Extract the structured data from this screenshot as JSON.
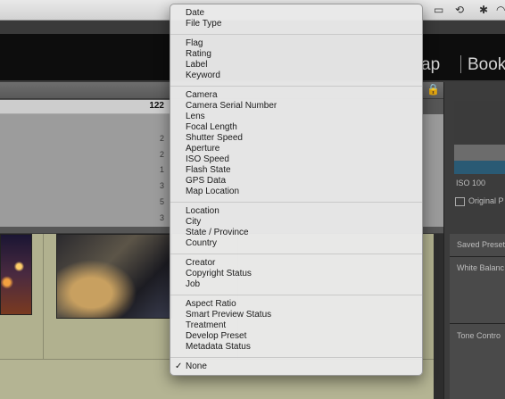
{
  "menubar": {
    "icons": [
      "screen-mirror-icon",
      "time-machine-icon",
      "bluetooth-icon",
      "wifi-icon"
    ]
  },
  "app": {
    "modules": [
      "ap",
      "Book"
    ]
  },
  "metadata_browser": {
    "header_count": "122",
    "counts": [
      "2",
      "2",
      "1",
      "3",
      "5",
      "3"
    ]
  },
  "right_panel": {
    "iso": "ISO 100",
    "original_label": "Original P",
    "sections": [
      "Saved Preset",
      "White Balanc",
      "Tone Contro"
    ]
  },
  "menu": {
    "groups": [
      [
        "Date",
        "File Type"
      ],
      [
        "Flag",
        "Rating",
        "Label",
        "Keyword"
      ],
      [
        "Camera",
        "Camera Serial Number",
        "Lens",
        "Focal Length",
        "Shutter Speed",
        "Aperture",
        "ISO Speed",
        "Flash State",
        "GPS Data",
        "Map Location"
      ],
      [
        "Location",
        "City",
        "State / Province",
        "Country"
      ],
      [
        "Creator",
        "Copyright Status",
        "Job"
      ],
      [
        "Aspect Ratio",
        "Smart Preview Status",
        "Treatment",
        "Develop Preset",
        "Metadata Status"
      ],
      [
        "None"
      ]
    ],
    "checked": "None",
    "checkmark": "✓"
  }
}
